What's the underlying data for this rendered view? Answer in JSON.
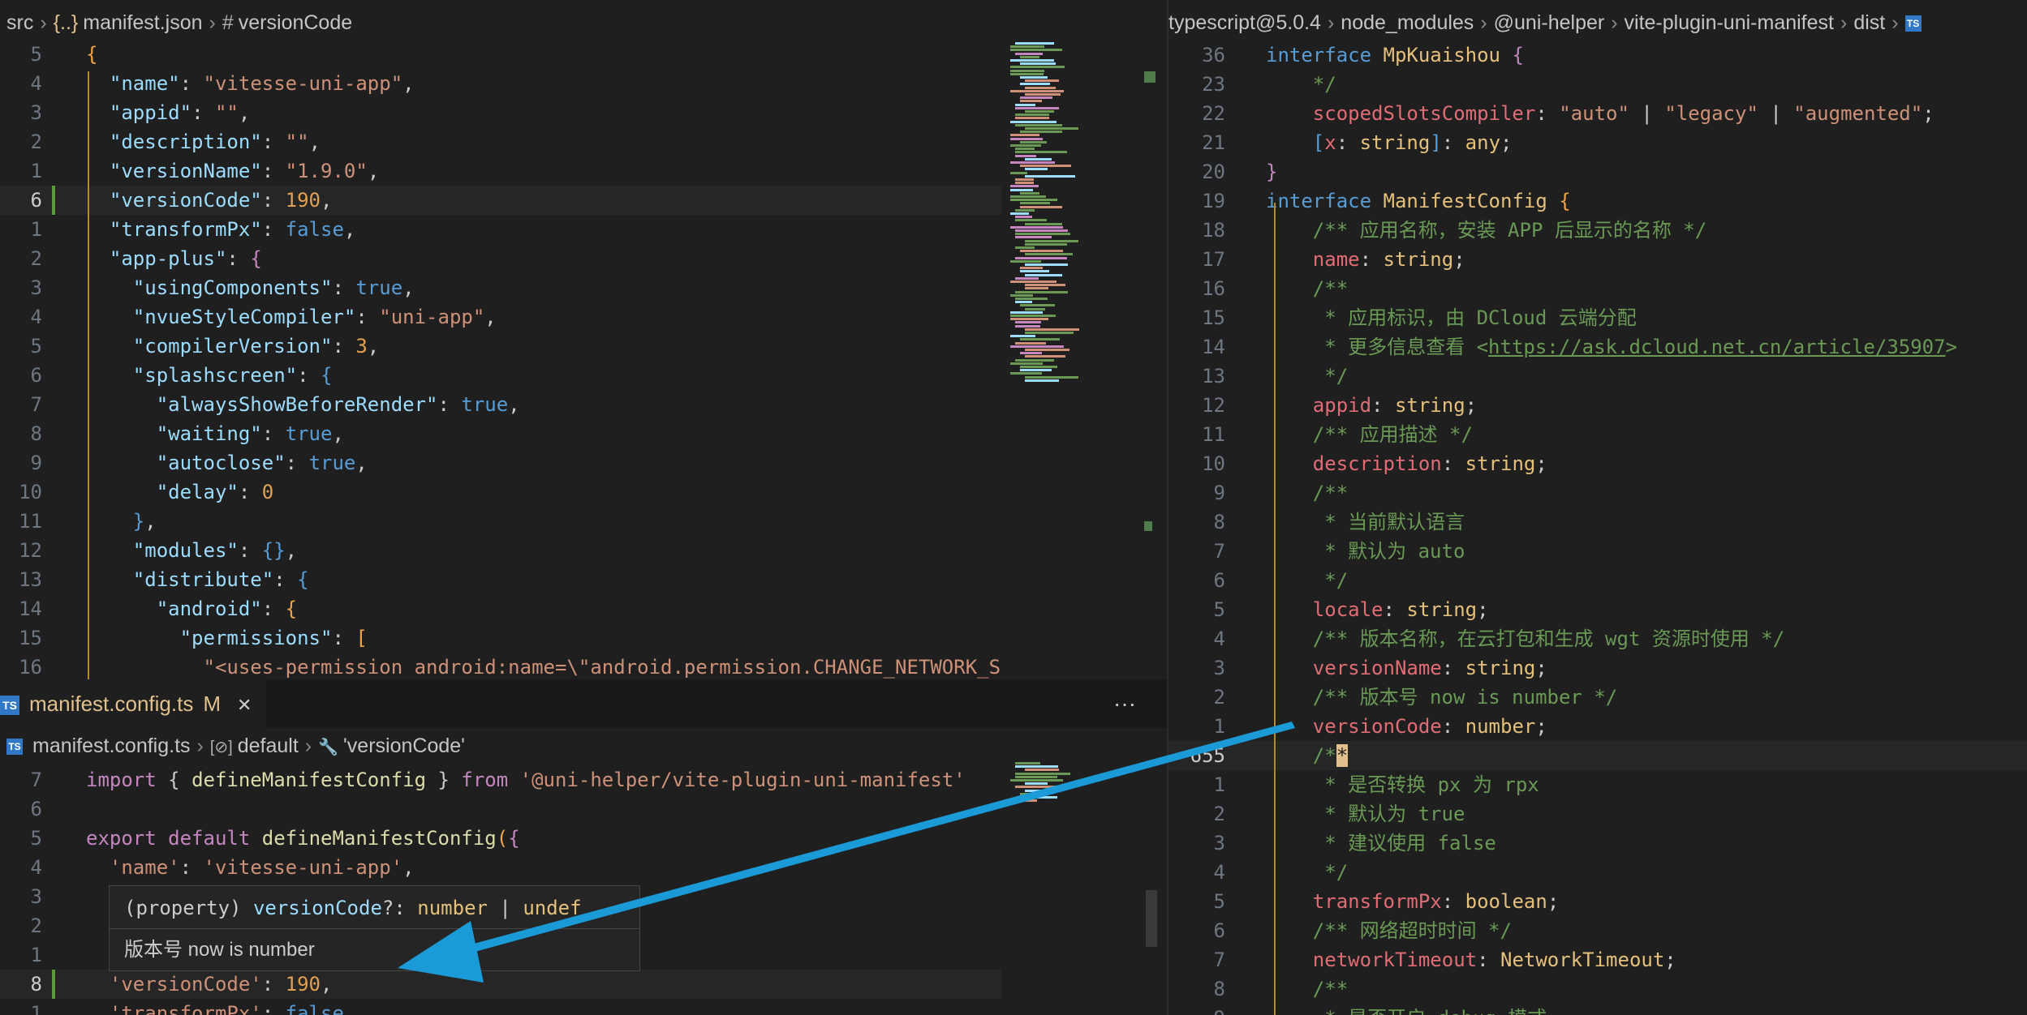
{
  "colors": {
    "arrow": "#1a9ad6",
    "accent": "#e2c08d",
    "modified": "#5b9b3a"
  },
  "left_top": {
    "breadcrumb": {
      "folder": "src",
      "file_icon": "json-braces-icon",
      "file_icon_text": "{..}",
      "file": "manifest.json",
      "symbol_icon_text": "#",
      "symbol": "versionCode"
    },
    "lines": [
      {
        "ln": "5",
        "html": "<span class='b'>{</span>"
      },
      {
        "ln": "4",
        "html": "  <span class='k'>\"name\"</span><span class='p'>: </span><span class='s'>\"vitesse-uni-app\"</span><span class='p'>,</span>"
      },
      {
        "ln": "3",
        "html": "  <span class='k'>\"appid\"</span><span class='p'>: </span><span class='s'>\"\"</span><span class='p'>,</span>"
      },
      {
        "ln": "2",
        "html": "  <span class='k'>\"description\"</span><span class='p'>: </span><span class='s'>\"\"</span><span class='p'>,</span>"
      },
      {
        "ln": "1",
        "html": "  <span class='k'>\"versionName\"</span><span class='p'>: </span><span class='s'>\"1.9.0\"</span><span class='p'>,</span>"
      },
      {
        "ln": "6",
        "cur": true,
        "html": "  <span class='k'>\"versionCode\"</span><span class='p'>: </span><span class='n'>190</span><span class='p'>,</span>"
      },
      {
        "ln": "1",
        "html": "  <span class='k'>\"transformPx\"</span><span class='p'>: </span><span class='kw2'>false</span><span class='p'>,</span>"
      },
      {
        "ln": "2",
        "html": "  <span class='k'>\"app-plus\"</span><span class='p'>: </span><span class='kw'>{</span>"
      },
      {
        "ln": "3",
        "html": "    <span class='k'>\"usingComponents\"</span><span class='p'>: </span><span class='kw2'>true</span><span class='p'>,</span>"
      },
      {
        "ln": "4",
        "html": "    <span class='k'>\"nvueStyleCompiler\"</span><span class='p'>: </span><span class='s'>\"uni-app\"</span><span class='p'>,</span>"
      },
      {
        "ln": "5",
        "html": "    <span class='k'>\"compilerVersion\"</span><span class='p'>: </span><span class='n'>3</span><span class='p'>,</span>"
      },
      {
        "ln": "6",
        "html": "    <span class='k'>\"splashscreen\"</span><span class='p'>: </span><span class='kw2'>{</span>"
      },
      {
        "ln": "7",
        "html": "      <span class='k'>\"alwaysShowBeforeRender\"</span><span class='p'>: </span><span class='kw2'>true</span><span class='p'>,</span>"
      },
      {
        "ln": "8",
        "html": "      <span class='k'>\"waiting\"</span><span class='p'>: </span><span class='kw2'>true</span><span class='p'>,</span>"
      },
      {
        "ln": "9",
        "html": "      <span class='k'>\"autoclose\"</span><span class='p'>: </span><span class='kw2'>true</span><span class='p'>,</span>"
      },
      {
        "ln": "10",
        "html": "      <span class='k'>\"delay\"</span><span class='p'>: </span><span class='n'>0</span>"
      },
      {
        "ln": "11",
        "html": "    <span class='kw2'>}</span><span class='p'>,</span>"
      },
      {
        "ln": "12",
        "html": "    <span class='k'>\"modules\"</span><span class='p'>: </span><span class='kw2'>{}</span><span class='p'>,</span>"
      },
      {
        "ln": "13",
        "html": "    <span class='k'>\"distribute\"</span><span class='p'>: </span><span class='kw2'>{</span>"
      },
      {
        "ln": "14",
        "html": "      <span class='k'>\"android\"</span><span class='p'>: </span><span class='b'>{</span>"
      },
      {
        "ln": "15",
        "html": "        <span class='k'>\"permissions\"</span><span class='p'>: </span><span class='b'>[</span>"
      },
      {
        "ln": "16",
        "html": "          <span class='s'>\"&lt;uses-permission android:name=\\\"android.permission.CHANGE_NETWORK_S</span>"
      }
    ]
  },
  "left_bottom": {
    "tab": {
      "icon_text": "TS",
      "label": "manifest.config.ts",
      "badge": "M",
      "close": "✕"
    },
    "more": "···",
    "breadcrumb": {
      "file_icon_text": "TS",
      "file": "manifest.config.ts",
      "symbol_icon_text": "[⊘]",
      "symbol": "default",
      "prop_icon_text": "🔧",
      "prop": "'versionCode'"
    },
    "lines": [
      {
        "ln": "7",
        "html": "<span class='kw'>import</span><span class='p'> { </span><span class='fn'>defineManifestConfig</span><span class='p'> } </span><span class='kw'>from</span><span class='p'> </span><span class='s'>'@uni-helper/vite-plugin-uni-manifest'</span>"
      },
      {
        "ln": "6",
        "html": ""
      },
      {
        "ln": "5",
        "html": "<span class='kw'>export</span><span class='p'> </span><span class='kw'>default</span><span class='p'> </span><span class='fn'>defineManifestConfig</span><span class='b'>(</span><span class='kw'>{</span>"
      },
      {
        "ln": "4",
        "html": "  <span class='s'>'name'</span><span class='p'>: </span><span class='s'>'vitesse-uni-app'</span><span class='p'>,</span>"
      },
      {
        "ln": "3",
        "html": ""
      },
      {
        "ln": "2",
        "html": ""
      },
      {
        "ln": "1",
        "html": ""
      },
      {
        "ln": "8",
        "cur": true,
        "html": "  <span class='s'>'versionCode'</span><span class='p'>: </span><span class='n'>190</span><span class='p'>,</span>"
      },
      {
        "ln": "1",
        "html": "  <span class='s'>'transformPx'</span><span class='p'>: </span><span class='kw2'>false</span>"
      }
    ],
    "tooltip": {
      "signature_html": "<span class='p'>(property) </span><span class='k'>versionCode</span><span class='p'>?: </span><span class='ty'>number</span><span class='p'> | </span><span class='ty'>undef</span>",
      "description": "版本号 now is number"
    }
  },
  "right": {
    "breadcrumb": {
      "segments": [
        "typescript@5.0.4",
        "node_modules",
        "@uni-helper",
        "vite-plugin-uni-manifest",
        "dist"
      ],
      "tail_icon_text": "TS"
    },
    "lines": [
      {
        "ln": "36",
        "html": "<span class='kw2'>interface</span><span class='p'> </span><span class='ty'>MpKuaishou</span><span class='p'> </span><span class='kw'>{</span>"
      },
      {
        "ln": "23",
        "html": "    <span class='cm'>*/</span>"
      },
      {
        "ln": "22",
        "html": "    <span class='pr'>scopedSlotsCompiler</span><span class='p'>: </span><span class='s'>\"auto\"</span><span class='p'> | </span><span class='s'>\"legacy\"</span><span class='p'> | </span><span class='s'>\"augmented\"</span><span class='p'>;</span>"
      },
      {
        "ln": "21",
        "html": "    <span class='kw2'>[</span><span class='pr'>x</span><span class='p'>: </span><span class='ty'>string</span><span class='kw2'>]</span><span class='p'>: </span><span class='ty'>any</span><span class='p'>;</span>"
      },
      {
        "ln": "20",
        "html": "<span class='kw'>}</span>"
      },
      {
        "ln": "19",
        "html": "<span class='kw2'>interface</span><span class='p'> </span><span class='ty'>ManifestConfig</span><span class='p'> </span><span class='b'>{</span>"
      },
      {
        "ln": "18",
        "html": "    <span class='cm'>/** 应用名称，安装 APP 后显示的名称 */</span>"
      },
      {
        "ln": "17",
        "html": "    <span class='pr'>name</span><span class='p'>: </span><span class='ty'>string</span><span class='p'>;</span>"
      },
      {
        "ln": "16",
        "html": "    <span class='cm'>/**</span>"
      },
      {
        "ln": "15",
        "html": "     <span class='cm'>* 应用标识，由 DCloud 云端分配</span>"
      },
      {
        "ln": "14",
        "html": "     <span class='cm'>* 更多信息查看 &lt;<u>https://ask.dcloud.net.cn/article/35907</u>&gt;</span>"
      },
      {
        "ln": "13",
        "html": "     <span class='cm'>*/</span>"
      },
      {
        "ln": "12",
        "html": "    <span class='pr'>appid</span><span class='p'>: </span><span class='ty'>string</span><span class='p'>;</span>"
      },
      {
        "ln": "11",
        "html": "    <span class='cm'>/** 应用描述 */</span>"
      },
      {
        "ln": "10",
        "html": "    <span class='pr'>description</span><span class='p'>: </span><span class='ty'>string</span><span class='p'>;</span>"
      },
      {
        "ln": "9",
        "html": "    <span class='cm'>/**</span>"
      },
      {
        "ln": "8",
        "html": "     <span class='cm'>* 当前默认语言</span>"
      },
      {
        "ln": "7",
        "html": "     <span class='cm'>* 默认为 auto</span>"
      },
      {
        "ln": "6",
        "html": "     <span class='cm'>*/</span>"
      },
      {
        "ln": "5",
        "html": "    <span class='pr'>locale</span><span class='p'>: </span><span class='ty'>string</span><span class='p'>;</span>"
      },
      {
        "ln": "4",
        "html": "    <span class='cm'>/** 版本名称，在云打包和生成 wgt 资源时使用 */</span>"
      },
      {
        "ln": "3",
        "html": "    <span class='pr'>versionName</span><span class='p'>: </span><span class='ty'>string</span><span class='p'>;</span>"
      },
      {
        "ln": "2",
        "html": "    <span class='cm'>/** 版本号 now is number */</span>"
      },
      {
        "ln": "1",
        "html": "    <span class='pr'>versionCode</span><span class='p'>: </span><span class='ty'>number</span><span class='p'>;</span>"
      },
      {
        "ln": "655",
        "cur": true,
        "html": "    <span class='cm'>/*</span><span style='background:#e2c08d;color:#1f1f1f'>*</span>"
      },
      {
        "ln": "1",
        "html": "     <span class='cm'>* 是否转换 px 为 rpx</span>"
      },
      {
        "ln": "2",
        "html": "     <span class='cm'>* 默认为 true</span>"
      },
      {
        "ln": "3",
        "html": "     <span class='cm'>* 建议使用 false</span>"
      },
      {
        "ln": "4",
        "html": "     <span class='cm'>*/</span>"
      },
      {
        "ln": "5",
        "html": "    <span class='pr'>transformPx</span><span class='p'>: </span><span class='ty'>boolean</span><span class='p'>;</span>"
      },
      {
        "ln": "6",
        "html": "    <span class='cm'>/** 网络超时时间 */</span>"
      },
      {
        "ln": "7",
        "html": "    <span class='pr'>networkTimeout</span><span class='p'>: </span><span class='ty'>NetworkTimeout</span><span class='p'>;</span>"
      },
      {
        "ln": "8",
        "html": "    <span class='cm'>/**</span>"
      },
      {
        "ln": "9",
        "html": "     <span class='cm'>* 是否开启 debug 模式</span>"
      }
    ]
  }
}
